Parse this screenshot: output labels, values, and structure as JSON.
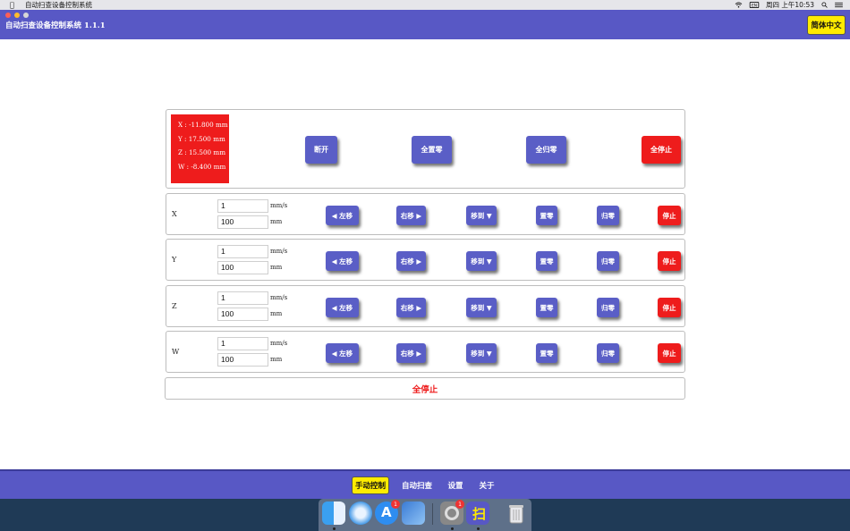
{
  "menubar": {
    "app_name": "自动扫查设备控制系统",
    "clock": "周四 上午10:53"
  },
  "window": {
    "title": "自动扫查设备控制系统 1.1.1",
    "language_button": "简体中文"
  },
  "status": {
    "coords": [
      "X : -11.800 mm",
      "Y : 17.500 mm",
      "Z : 15.500 mm",
      "W : -8.400 mm"
    ],
    "disconnect": "断开",
    "all_zero": "全置零",
    "all_home": "全归零",
    "all_stop": "全停止"
  },
  "axes": [
    {
      "label": "X",
      "speed": "1",
      "distance": "100"
    },
    {
      "label": "Y",
      "speed": "1",
      "distance": "100"
    },
    {
      "label": "Z",
      "speed": "1",
      "distance": "100"
    },
    {
      "label": "W",
      "speed": "1",
      "distance": "100"
    }
  ],
  "units": {
    "speed": "mm/s",
    "distance": "mm"
  },
  "row_buttons": {
    "move_left": "◀ 左移",
    "move_right": "右移 ▶",
    "move_to": "移到 ▼",
    "set_zero": "置零",
    "home": "归零",
    "stop": "停止"
  },
  "stop_all_bar": "全停止",
  "tabs": [
    "手动控制",
    "自动扫查",
    "设置",
    "关于"
  ],
  "dock": {
    "badges": [
      "1",
      "1"
    ]
  },
  "colors": {
    "accent": "#5858c5",
    "button": "#5a5ec6",
    "danger": "#ee1c1c",
    "highlight": "#ffeb00"
  }
}
